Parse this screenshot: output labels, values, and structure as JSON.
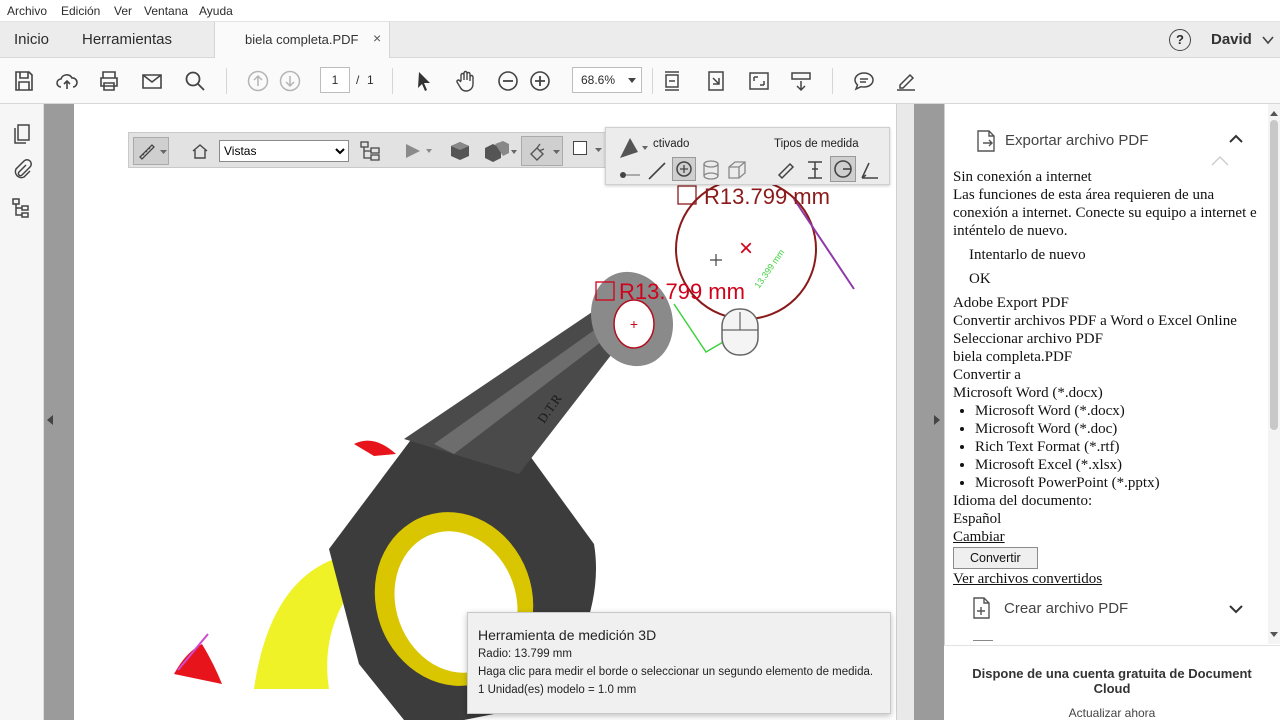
{
  "menu": [
    "Archivo",
    "Edición",
    "Ver",
    "Ventana",
    "Ayuda"
  ],
  "tabs": {
    "home": "Inicio",
    "tools": "Herramientas",
    "document": "biela completa.PDF",
    "close": "×",
    "help": "?",
    "user": "David"
  },
  "toolbar": {
    "page_current": "1",
    "page_sep": "/",
    "page_total": "1",
    "zoom": "68.6%"
  },
  "toolbar3d": {
    "views_value": "Vistas",
    "activated_label": "ctivado",
    "measure_types_label": "Tipos de medida"
  },
  "measurements": {
    "radius_label_top": "R13.799  mm",
    "radius_label_bottom": "R13.799  mm",
    "small_label": "13.399 mm",
    "engraving": "D.T.R"
  },
  "tooltip": {
    "title": "Herramienta de medición 3D",
    "line1": "Radio: 13.799 mm",
    "line2": "Haga clic para medir el borde o seleccionar un segundo elemento de medida.",
    "line3": "1 Unidad(es) modelo = 1.0 mm"
  },
  "rightpane": {
    "export_header": "Exportar archivo PDF",
    "offline_title": "Sin conexión a internet",
    "offline_message": "Las funciones de esta área requieren de una conexión a internet. Conecte su equipo a internet e inténtelo de nuevo.",
    "retry": "Intentarlo de nuevo",
    "ok": "OK",
    "export_title": "Adobe Export PDF",
    "export_desc": "Convertir archivos PDF a Word o Excel Online",
    "select_label": "Seleccionar archivo PDF",
    "selected_file": "biela completa.PDF",
    "convert_to_label": "Convertir a",
    "convert_to_value": "Microsoft Word (*.docx)",
    "formats": [
      "Microsoft Word (*.docx)",
      "Microsoft Word (*.doc)",
      "Rich Text Format (*.rtf)",
      "Microsoft Excel (*.xlsx)",
      "Microsoft PowerPoint (*.pptx)"
    ],
    "language_label": "Idioma del documento:",
    "language_value": "Español",
    "change_link": "Cambiar",
    "convert_button": "Convertir",
    "view_converted": "Ver archivos convertidos",
    "create_header": "Crear archivo PDF",
    "footer_text": "Dispone de una cuenta gratuita de Document Cloud",
    "footer_link": "Actualizar ahora"
  },
  "colors": {
    "measure_red": "#d0021b",
    "measure_green": "#3fd13f",
    "rod_dark": "#3c3c3c",
    "bearing_yellow": "#e6d200"
  }
}
